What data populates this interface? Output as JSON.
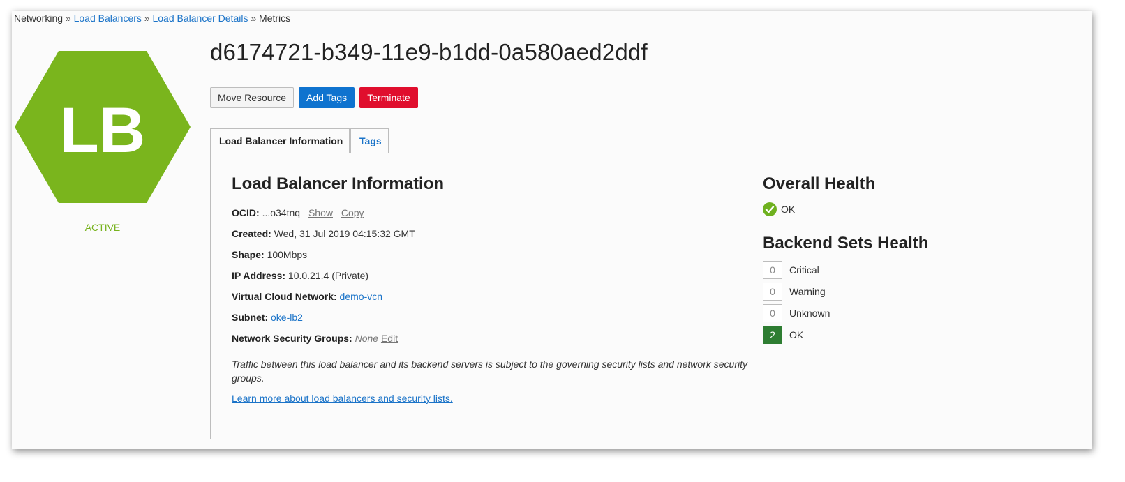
{
  "breadcrumb": {
    "items": [
      "Networking",
      "Load Balancers",
      "Load Balancer Details",
      "Metrics"
    ],
    "separator": "»"
  },
  "resource": {
    "icon_text": "LB",
    "icon_color": "#7ab51d",
    "status": "ACTIVE",
    "status_color": "#78b31e",
    "title": "d6174721-b349-11e9-b1dd-0a580aed2ddf"
  },
  "actions": {
    "move": "Move Resource",
    "add_tags": "Add Tags",
    "terminate": "Terminate"
  },
  "tabs": [
    {
      "label": "Load Balancer Information",
      "active": true
    },
    {
      "label": "Tags",
      "active": false
    }
  ],
  "info": {
    "heading": "Load Balancer Information",
    "ocid_label": "OCID:",
    "ocid_value": "...o34tnq",
    "show_link": "Show",
    "copy_link": "Copy",
    "created_label": "Created:",
    "created_value": "Wed, 31 Jul 2019 04:15:32 GMT",
    "shape_label": "Shape:",
    "shape_value": "100Mbps",
    "ip_label": "IP Address:",
    "ip_value": "10.0.21.4 (Private)",
    "vcn_label": "Virtual Cloud Network:",
    "vcn_value": "demo-vcn",
    "subnet_label": "Subnet:",
    "subnet_value": "oke-lb2",
    "nsg_label": "Network Security Groups:",
    "nsg_value": "None",
    "nsg_edit": "Edit",
    "note": "Traffic between this load balancer and its backend servers is subject to the governing security lists and network security groups.",
    "learn_more": "Learn more about load balancers and security lists."
  },
  "health": {
    "overall_heading": "Overall Health",
    "overall_status": "OK",
    "backend_heading": "Backend Sets Health",
    "counts": [
      {
        "value": "0",
        "label": "Critical"
      },
      {
        "value": "0",
        "label": "Warning"
      },
      {
        "value": "0",
        "label": "Unknown"
      },
      {
        "value": "2",
        "label": "OK"
      }
    ]
  }
}
